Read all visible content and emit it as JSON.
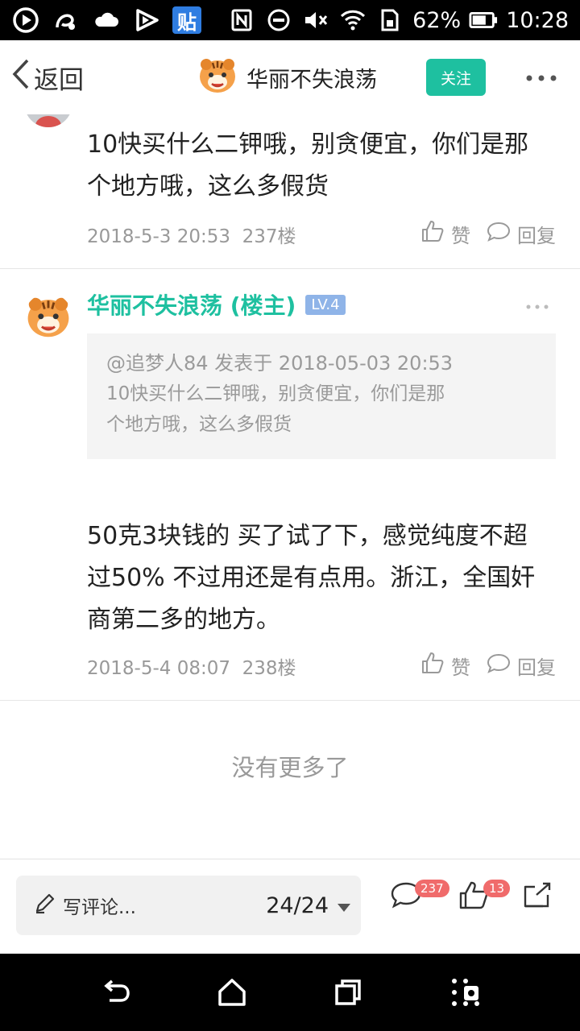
{
  "status_bar": {
    "tieba_label": "贴",
    "battery": "62%",
    "time": "10:28",
    "left_icons": [
      "play-circle-icon",
      "uc-browser-icon",
      "cloud-icon",
      "video-play-icon",
      "tieba-icon"
    ],
    "right_icons": [
      "nfc-icon",
      "do-not-disturb-icon",
      "mute-icon",
      "wifi-icon",
      "sim-icon",
      "battery-icon"
    ]
  },
  "header": {
    "back_label": "返回",
    "title": "华丽不失浪荡",
    "follow_label": "关注"
  },
  "posts": [
    {
      "text_line1": "10快买什么二钾哦，别贪便宜，你们是那",
      "text_line2": "个地方哦，这么多假货",
      "time": "2018-5-3 20:53",
      "floor": "237楼",
      "like_label": "赞",
      "reply_label": "回复"
    },
    {
      "author": "华丽不失浪荡 (楼主)",
      "level": "LV.4",
      "quote_head": "@追梦人84 发表于 2018-05-03 20:53",
      "quote_line1": "10快买什么二钾哦，别贪便宜，你们是那",
      "quote_line2": "个地方哦，这么多假货",
      "text_line1": "50克3块钱的 买了试了下，感觉纯度不超",
      "text_line2": "过50% 不过用还是有点用。浙江，全国奸",
      "text_line3": "商第二多的地方。",
      "time": "2018-5-4 08:07",
      "floor": "238楼",
      "like_label": "赞",
      "reply_label": "回复"
    }
  ],
  "no_more_label": "没有更多了",
  "bottom_bar": {
    "comment_placeholder": "写评论...",
    "page_indicator": "24/24",
    "comment_count": "237",
    "like_count": "13"
  },
  "colors": {
    "accent": "#1ec0a0",
    "badge": "#f06b6b",
    "level_badge": "#8fb4e8"
  }
}
